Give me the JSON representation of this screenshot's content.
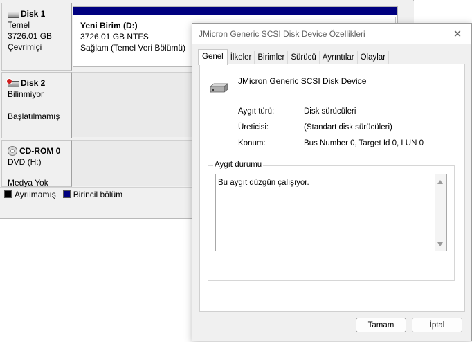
{
  "disk_management": {
    "disks": [
      {
        "name": "Disk 1",
        "type": "Temel",
        "size": "3726.01 GB",
        "status": "Çevrimiçi"
      },
      {
        "name": "Disk 2",
        "type": "Bilinmiyor",
        "size": "",
        "status": "Başlatılmamış"
      },
      {
        "name": "CD-ROM 0",
        "type": "DVD (H:)",
        "size": "",
        "status": "Medya Yok"
      }
    ],
    "partition": {
      "name": "Yeni Birim  (D:)",
      "size": "3726.01 GB NTFS",
      "status": "Sağlam (Temel Veri Bölümü)"
    },
    "legend": [
      {
        "label": "Ayrılmamış",
        "color": "#000000"
      },
      {
        "label": "Birincil bölüm",
        "color": "#00007f"
      }
    ]
  },
  "dialog": {
    "title": "JMicron Generic SCSI Disk Device Özellikleri",
    "close_glyph": "✕",
    "tabs": [
      "Genel",
      "İlkeler",
      "Birimler",
      "Sürücü",
      "Ayrıntılar",
      "Olaylar"
    ],
    "active_tab": "Genel",
    "device_name": "JMicron Generic SCSI Disk Device",
    "properties": [
      {
        "label": "Aygıt türü:",
        "value": "Disk sürücüleri"
      },
      {
        "label": "Üreticisi:",
        "value": "(Standart disk sürücüleri)"
      },
      {
        "label": "Konum:",
        "value": "Bus Number 0, Target Id 0, LUN 0"
      }
    ],
    "status_group_title": "Aygıt durumu",
    "status_text": "Bu aygıt düzgün çalışıyor.",
    "ok_label": "Tamam",
    "cancel_label": "İptal"
  },
  "icons": {
    "disk": "hard-disk-icon",
    "disk_error": "disk-error-icon",
    "cdrom": "cdrom-icon",
    "device": "device-drive-icon"
  }
}
